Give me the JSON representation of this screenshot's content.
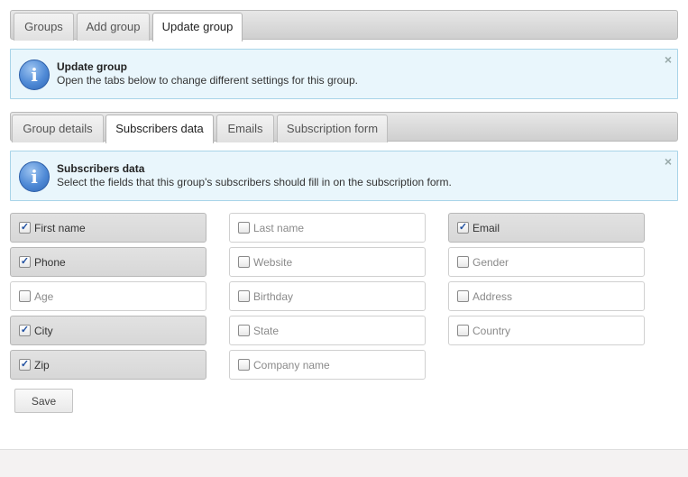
{
  "top_tabs": [
    {
      "label": "Groups",
      "active": false
    },
    {
      "label": "Add group",
      "active": false
    },
    {
      "label": "Update group",
      "active": true
    }
  ],
  "info_update": {
    "icon": "info-icon",
    "title": "Update group",
    "text": "Open the tabs below to change different settings for this group.",
    "close": "×"
  },
  "sub_tabs": [
    {
      "label": "Group details",
      "active": false
    },
    {
      "label": "Subscribers data",
      "active": true
    },
    {
      "label": "Emails",
      "active": false
    },
    {
      "label": "Subscription form",
      "active": false
    }
  ],
  "info_subscribers": {
    "icon": "info-icon",
    "title": "Subscribers data",
    "text": "Select the fields that this group's subscribers should fill in on the subscription form.",
    "close": "×"
  },
  "fields": [
    {
      "label": "First name",
      "checked": true
    },
    {
      "label": "Last name",
      "checked": false
    },
    {
      "label": "Email",
      "checked": true
    },
    {
      "label": "Phone",
      "checked": true
    },
    {
      "label": "Website",
      "checked": false
    },
    {
      "label": "Gender",
      "checked": false
    },
    {
      "label": "Age",
      "checked": false
    },
    {
      "label": "Birthday",
      "checked": false
    },
    {
      "label": "Address",
      "checked": false
    },
    {
      "label": "City",
      "checked": true
    },
    {
      "label": "State",
      "checked": false
    },
    {
      "label": "Country",
      "checked": false
    },
    {
      "label": "Zip",
      "checked": true
    },
    {
      "label": "Company name",
      "checked": false
    }
  ],
  "save_label": "Save",
  "checkmark": "✓"
}
